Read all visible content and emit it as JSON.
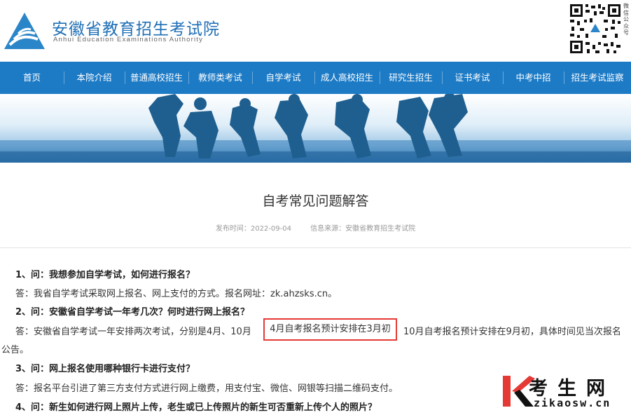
{
  "header": {
    "title": "安徽省教育招生考试院",
    "subtitle": "Anhui Education Examinations Authority",
    "qr_label": "微信公众号",
    "brand_color": "#1d7bc6"
  },
  "nav": {
    "items": [
      {
        "label": "首页"
      },
      {
        "label": "本院介绍"
      },
      {
        "label": "普通高校招生"
      },
      {
        "label": "教师类考试"
      },
      {
        "label": "自学考试"
      },
      {
        "label": "成人高校招生"
      },
      {
        "label": "研究生招生"
      },
      {
        "label": "证书考试"
      },
      {
        "label": "中考中招"
      },
      {
        "label": "招生考试监察"
      }
    ]
  },
  "article": {
    "title": "自考常见问题解答",
    "publish_time": "发布时间：2022-09-04",
    "source": "信息来源：安徽省教育招生考试院",
    "q1": "1、问：我想参加自学考试，如何进行报名？",
    "a1": "答：我省自学考试采取网上报名、网上支付的方式。报名网址：zk.ahzsks.cn。",
    "q2": "2、问：安徽省自学考试一年考几次？何时进行网上报名？",
    "a2_part1": "答：安徽省自学考试一年安排两次考试，分别是4月、10月",
    "a2_highlight": "4月自考报名预计安排在3月初",
    "a2_part2": "10月自考报名预计安排在9月初，具体时间见当次报名",
    "a2_part3": "公告。",
    "q3": "3、问：网上报名使用哪种银行卡进行支付？",
    "a3": "答：报名平台引进了第三方支付方式进行网上缴费，用支付宝、微信、网银等扫描二维码支付。",
    "q4": "4、问：新生如何进行网上照片上传，老生或已上传照片的新生可否重新上传个人的照片？",
    "highlight_color": "#e53935"
  },
  "watermark": {
    "text": "考生网",
    "url": "zikaosw.cn"
  }
}
